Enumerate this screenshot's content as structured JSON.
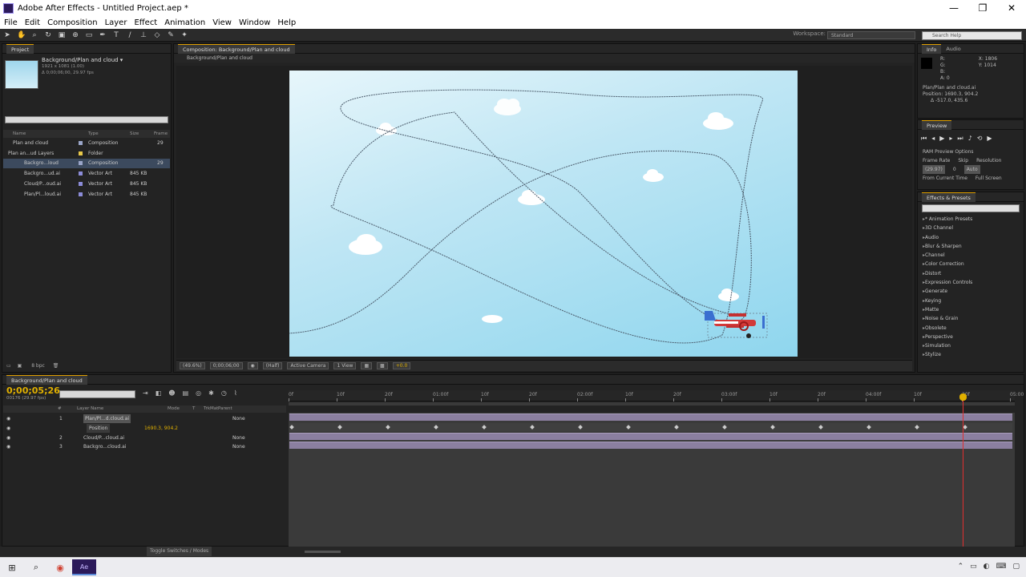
{
  "window": {
    "title": "Adobe After Effects - Untitled Project.aep *",
    "minimize": "—",
    "maximize": "❐",
    "close": "✕"
  },
  "menu": [
    "File",
    "Edit",
    "Composition",
    "Layer",
    "Effect",
    "Animation",
    "View",
    "Window",
    "Help"
  ],
  "toolbar": {
    "workspace_label": "Workspace:",
    "workspace_value": "Standard",
    "search_placeholder": "Search Help"
  },
  "project_panel": {
    "tab": "Project",
    "selected_name": "Background/Plan and cloud ▾",
    "selected_dims": "1921 x 1081 (1.00)",
    "selected_meta": "Δ 0;00;06;00, 29.97 fps",
    "columns": [
      "Name",
      "Type",
      "Size",
      "Frame"
    ],
    "items": [
      {
        "name": "Plan and cloud",
        "type": "Composition",
        "size": "",
        "frame": "29",
        "color": "#9aa5c8"
      },
      {
        "name": "Plan an...ud Layers",
        "type": "Folder",
        "size": "",
        "frame": "",
        "color": "#e8c84a"
      },
      {
        "name": "Backgro...loud",
        "type": "Composition",
        "size": "",
        "frame": "29",
        "color": "#9aa5c8"
      },
      {
        "name": "Backgro...ud.ai",
        "type": "Vector Art",
        "size": "845 KB",
        "frame": "",
        "color": "#8c8cd8"
      },
      {
        "name": "Cloud/P...oud.ai",
        "type": "Vector Art",
        "size": "845 KB",
        "frame": "",
        "color": "#8c8cd8"
      },
      {
        "name": "Plan/Pl...loud.ai",
        "type": "Vector Art",
        "size": "845 KB",
        "frame": "",
        "color": "#8c8cd8"
      }
    ],
    "footer": "8 bpc"
  },
  "composition": {
    "tab": "Composition: Background/Plan and cloud",
    "breadcrumb": "Background/Plan and cloud",
    "bar": {
      "zoom": "(49.6%)",
      "timecode": "0;00;06;00",
      "resolution": "(Half)",
      "view": "Active Camera",
      "views": "1 View",
      "exposure": "+0.0"
    }
  },
  "info_panel": {
    "tabs": [
      "Info",
      "Audio"
    ],
    "rgb": [
      "R:",
      "G:",
      "B:",
      "A: 0"
    ],
    "xy": [
      "X: 1806",
      "Y: 1014"
    ],
    "layer_name": "Plan/Plan and cloud.ai",
    "position": "Position: 1690.3, 904.2",
    "delta": "Δ -517.0, 435.6"
  },
  "preview_panel": {
    "tab": "Preview",
    "options_label": "RAM Preview Options",
    "frame_rate_label": "Frame Rate",
    "skip_label": "Skip",
    "resolution_label": "Resolution",
    "frame_rate": "(29.97)",
    "skip": "0",
    "resolution": "Auto",
    "from_current": "From Current Time",
    "full_screen": "Full Screen"
  },
  "effects_panel": {
    "tab": "Effects & Presets",
    "items": [
      "* Animation Presets",
      "3D Channel",
      "Audio",
      "Blur & Sharpen",
      "Channel",
      "Color Correction",
      "Distort",
      "Expression Controls",
      "Generate",
      "Keying",
      "Matte",
      "Noise & Grain",
      "Obsolete",
      "Perspective",
      "Simulation",
      "Stylize"
    ]
  },
  "timeline": {
    "tab": "Background/Plan and cloud",
    "timecode": "0;00;05;26",
    "timecode_sub": "00176 (29.97 fps)",
    "columns": [
      "#",
      "Layer Name",
      "Mode",
      "T",
      "TrkMat",
      "Parent"
    ],
    "layers": [
      {
        "num": "1",
        "name": "Plan/Pl...d.cloud.ai",
        "mode": "",
        "parent": "None"
      },
      {
        "num": "",
        "name": "Position",
        "mode": "",
        "parent": "1690.3, 904.2"
      },
      {
        "num": "2",
        "name": "Cloud/P...cloud.ai",
        "mode": "",
        "parent": "None"
      },
      {
        "num": "3",
        "name": "Backgro...cloud.ai",
        "mode": "",
        "parent": "None"
      }
    ],
    "ruler": [
      "0f",
      "10f",
      "20f",
      "01:00f",
      "10f",
      "20f",
      "02:00f",
      "10f",
      "20f",
      "03:00f",
      "10f",
      "20f",
      "04:00f",
      "10f",
      "20f",
      "05:00"
    ],
    "footer": "Toggle Switches / Modes",
    "playhead_frac": 0.931
  },
  "taskbar": {
    "start": "⊞",
    "search": "⌕",
    "chrome": "◉",
    "ae": "Ae",
    "tray": [
      "⌃",
      "▭",
      "◐",
      "⌨",
      "▢"
    ]
  }
}
